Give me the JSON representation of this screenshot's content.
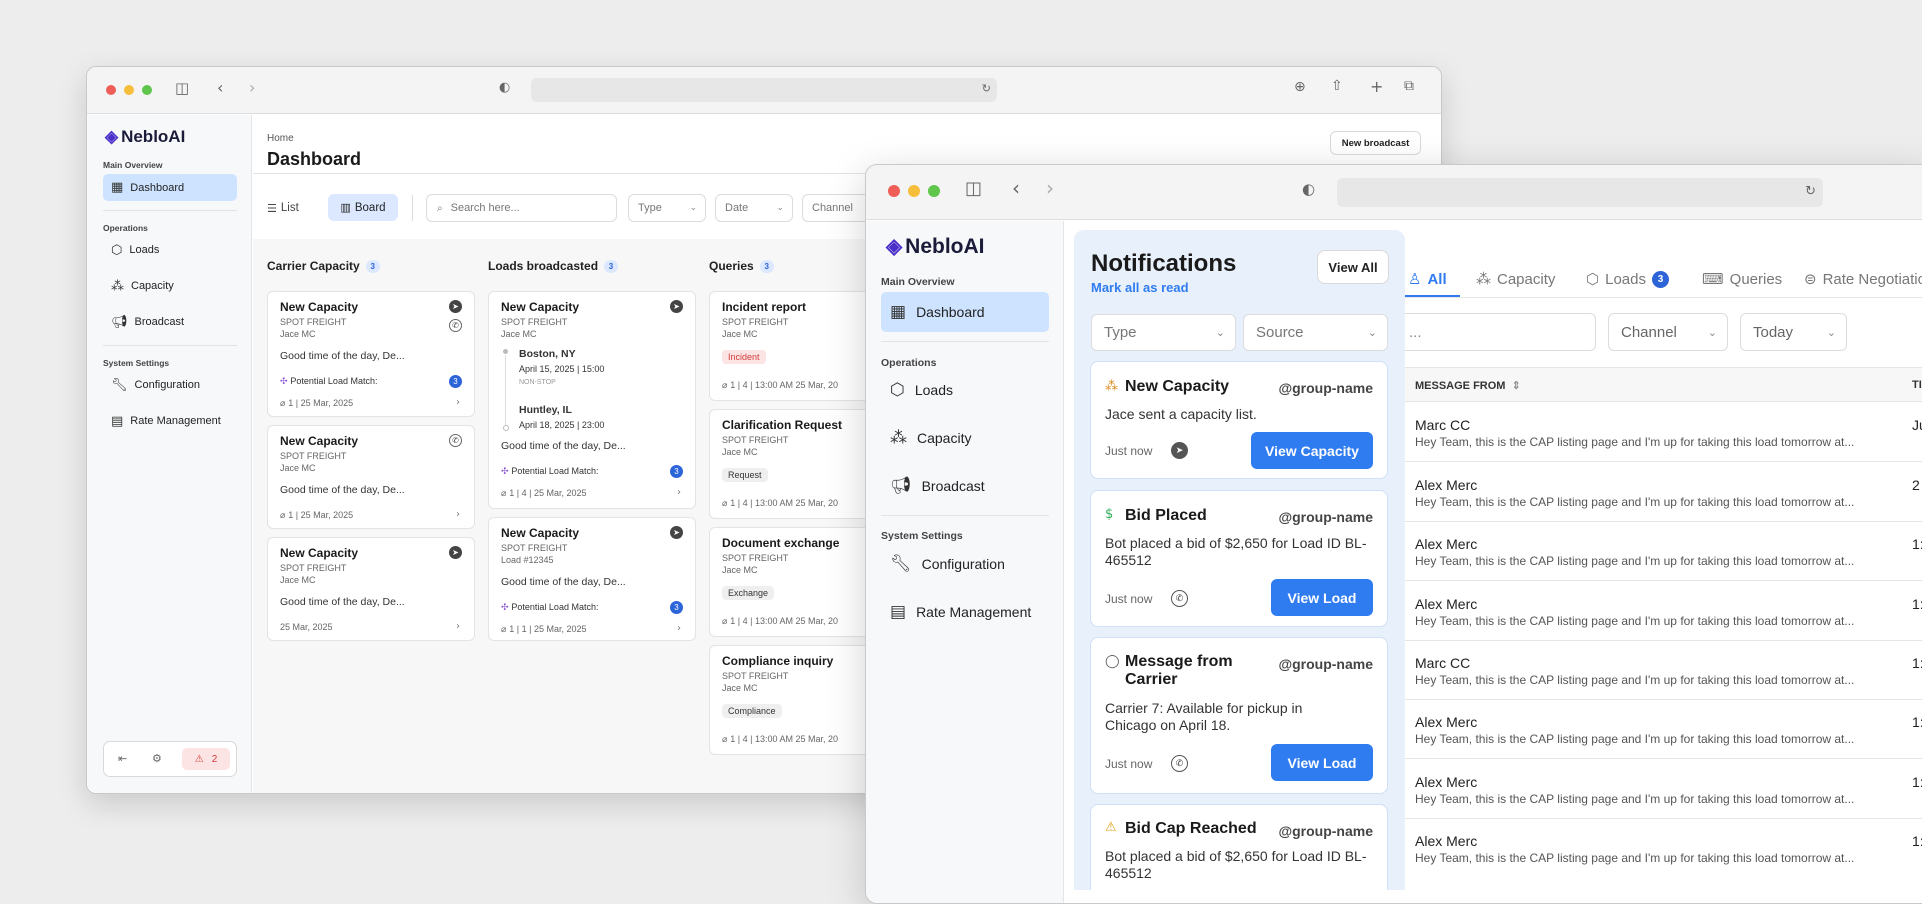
{
  "back_window": {
    "logo": "NebloAI",
    "sidebar": {
      "main_overview": "Main Overview",
      "dashboard": "Dashboard",
      "operations": "Operations",
      "loads": "Loads",
      "capacity": "Capacity",
      "broadcast": "Broadcast",
      "system_settings": "System Settings",
      "configuration": "Configuration",
      "rate_management": "Rate Management",
      "bottom_badge": "2"
    },
    "breadcrumb": "Home",
    "page_title": "Dashboard",
    "new_broadcast": "New broadcast",
    "view_list": "List",
    "view_board": "Board",
    "search_placeholder": "Search here...",
    "filter_type": "Type",
    "filter_date": "Date",
    "filter_channel": "Channel",
    "columns": [
      {
        "title": "Carrier Capacity",
        "count": "3"
      },
      {
        "title": "Loads broadcasted",
        "count": "3"
      },
      {
        "title": "Queries",
        "count": "3"
      }
    ],
    "capacity_cards": [
      {
        "title": "New Capacity",
        "sub": "SPOT FREIGHT",
        "person": "Jace MC",
        "body": "Good time of the day, De...",
        "match": "Potential Load Match:",
        "match_count": "3",
        "meta": "1 | 25 Mar, 2025"
      },
      {
        "title": "New Capacity",
        "sub": "SPOT FREIGHT",
        "person": "Jace MC",
        "body": "Good time of the day, De...",
        "meta": "1 | 25 Mar, 2025"
      },
      {
        "title": "New Capacity",
        "sub": "SPOT FREIGHT",
        "person": "Jace MC",
        "body": "Good time of the day, De...",
        "meta": "25 Mar, 2025"
      }
    ],
    "load_cards": [
      {
        "title": "New Capacity",
        "sub": "SPOT FREIGHT",
        "person": "Jace MC",
        "origin": "Boston, NY",
        "origin_date": "April 15, 2025 | 15:00",
        "stop": "NON-STOP",
        "dest": "Huntley, IL",
        "dest_date": "April 18, 2025 | 23:00",
        "body": "Good time of the day, De...",
        "match": "Potential Load Match:",
        "match_count": "3",
        "meta": "1 | 4 | 25 Mar, 2025"
      },
      {
        "title": "New Capacity",
        "sub": "SPOT FREIGHT",
        "person": "Load #12345",
        "body": "Good time of the day, De...",
        "match": "Potential Load Match:",
        "match_count": "3",
        "meta": "1 | 1 | 25 Mar, 2025"
      }
    ],
    "query_cards": [
      {
        "title": "Incident report",
        "sub": "SPOT FREIGHT",
        "person": "Jace MC",
        "tag": "Incident",
        "meta": "1 | 4 | 13:00 AM 25 Mar, 20"
      },
      {
        "title": "Clarification Request",
        "sub": "SPOT FREIGHT",
        "person": "Jace MC",
        "tag": "Request",
        "meta": "1 | 4 | 13:00 AM 25 Mar, 20"
      },
      {
        "title": "Document exchange",
        "sub": "SPOT FREIGHT",
        "person": "Jace MC",
        "tag": "Exchange",
        "meta": "1 | 4 | 13:00 AM 25 Mar, 20"
      },
      {
        "title": "Compliance inquiry",
        "sub": "SPOT FREIGHT",
        "person": "Jace MC",
        "tag": "Compliance",
        "meta": "1 | 4 | 13:00 AM 25 Mar, 20"
      }
    ]
  },
  "front_window": {
    "logo": "NebloAI",
    "sidebar": {
      "main_overview": "Main Overview",
      "dashboard": "Dashboard",
      "operations": "Operations",
      "loads": "Loads",
      "capacity": "Capacity",
      "broadcast": "Broadcast",
      "system_settings": "System Settings",
      "configuration": "Configuration",
      "rate_management": "Rate Management"
    },
    "notifications": {
      "title": "Notifications",
      "mark_all": "Mark all as read",
      "view_all": "View All",
      "filter_type": "Type",
      "filter_source": "Source",
      "items": [
        {
          "title": "New Capacity",
          "group": "@group-name",
          "body": "Jace sent a capacity list.",
          "time": "Just now",
          "button": "View Capacity"
        },
        {
          "title": "Bid Placed",
          "group": "@group-name",
          "body": "Bot placed a bid of $2,650 for Load ID BL-465512",
          "time": "Just now",
          "button": "View Load"
        },
        {
          "title": "Message from Carrier",
          "group": "@group-name",
          "body": "Carrier 7: Available for pickup in Chicago on April 18.",
          "time": "Just now",
          "button": "View Load"
        },
        {
          "title": "Bid Cap Reached",
          "group": "@group-name",
          "body": "Bot placed a bid of $2,650 for Load ID BL-465512"
        }
      ]
    },
    "tabs": {
      "all": "All",
      "capacity": "Capacity",
      "loads": "Loads",
      "loads_count": "3",
      "queries": "Queries",
      "rate": "Rate Negotiatio"
    },
    "search_partial": "...",
    "filter_channel": "Channel",
    "filter_today": "Today",
    "table": {
      "header": "MESSAGE FROM",
      "header2": "TI",
      "rows": [
        {
          "name": "Marc CC",
          "msg": "Hey Team, this is the CAP listing page and I'm up for taking this load tomorrow at...",
          "time": "Ju"
        },
        {
          "name": "Alex Merc",
          "msg": "Hey Team, this is the CAP listing page and I'm up for taking this load tomorrow at...",
          "time": "2"
        },
        {
          "name": "Alex Merc",
          "msg": "Hey Team, this is the CAP listing page and I'm up for taking this load tomorrow at...",
          "time": "1:"
        },
        {
          "name": "Alex Merc",
          "msg": "Hey Team, this is the CAP listing page and I'm up for taking this load tomorrow at...",
          "time": "1:"
        },
        {
          "name": "Marc CC",
          "msg": "Hey Team, this is the CAP listing page and I'm up for taking this load tomorrow at...",
          "time": "1:"
        },
        {
          "name": "Alex Merc",
          "msg": "Hey Team, this is the CAP listing page and I'm up for taking this load tomorrow at...",
          "time": "1:"
        },
        {
          "name": "Alex Merc",
          "msg": "Hey Team, this is the CAP listing page and I'm up for taking this load tomorrow at...",
          "time": "1:"
        },
        {
          "name": "Alex Merc",
          "msg": "Hey Team, this is the CAP listing page and I'm up for taking this load tomorrow at...",
          "time": "1:"
        }
      ]
    }
  },
  "colors": {
    "accent": "#2f7cf0",
    "brand": "#4b2fc9",
    "active_nav": "#cde3ff",
    "incident": "#fde4e4"
  }
}
